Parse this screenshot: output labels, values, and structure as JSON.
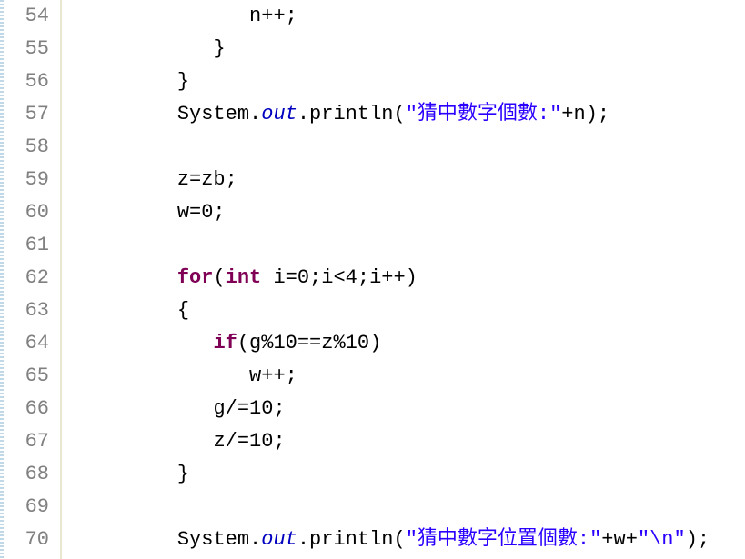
{
  "gutter": {
    "start": 54,
    "end": 70,
    "lines": [
      "54",
      "55",
      "56",
      "57",
      "58",
      "59",
      "60",
      "61",
      "62",
      "63",
      "64",
      "65",
      "66",
      "67",
      "68",
      "69",
      "70"
    ]
  },
  "code": {
    "l54": {
      "indent": "               ",
      "t1": "n++;"
    },
    "l55": {
      "indent": "            ",
      "t1": "}"
    },
    "l56": {
      "indent": "         ",
      "t1": "}"
    },
    "l57": {
      "indent": "         ",
      "t1": "System.",
      "field": "out",
      "t2": ".println(",
      "str": "\"猜中數字個數:\"",
      "t3": "+n);"
    },
    "l58": {
      "indent": "",
      "t1": ""
    },
    "l59": {
      "indent": "         ",
      "t1": "z=zb;"
    },
    "l60": {
      "indent": "         ",
      "t1": "w=0;"
    },
    "l61": {
      "indent": "",
      "t1": ""
    },
    "l62": {
      "indent": "         ",
      "kw1": "for",
      "t1": "(",
      "kw2": "int",
      "t2": " i=0;i<4;i++)"
    },
    "l63": {
      "indent": "         ",
      "t1": "{"
    },
    "l64": {
      "indent": "            ",
      "kw1": "if",
      "t1": "(g%10==z%10)"
    },
    "l65": {
      "indent": "               ",
      "t1": "w++;"
    },
    "l66": {
      "indent": "            ",
      "t1": "g/=10;"
    },
    "l67": {
      "indent": "            ",
      "t1": "z/=10;"
    },
    "l68": {
      "indent": "         ",
      "t1": "}"
    },
    "l69": {
      "indent": "",
      "t1": ""
    },
    "l70": {
      "indent": "         ",
      "t1": "System.",
      "field": "out",
      "t2": ".println(",
      "str": "\"猜中數字位置個數:\"",
      "t3": "+w+",
      "str2": "\"\\n\"",
      "t4": ");"
    }
  }
}
